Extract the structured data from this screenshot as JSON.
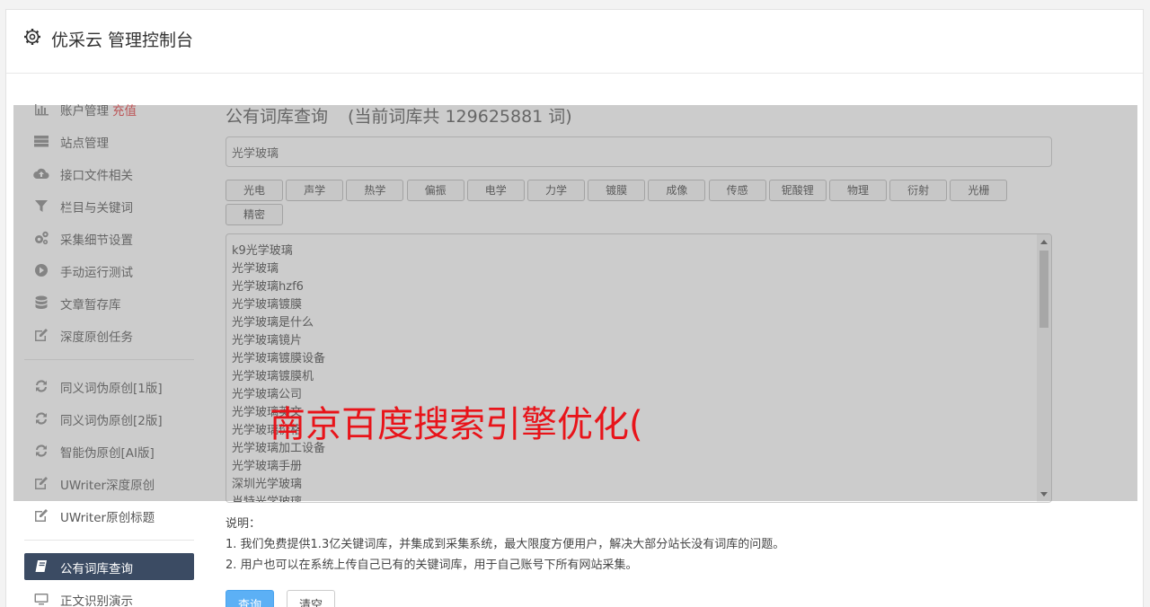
{
  "header": {
    "title": "优采云 管理控制台"
  },
  "sidebar": {
    "items": [
      {
        "label": "账户管理",
        "extra": "充值",
        "icon": "bar-chart-icon"
      },
      {
        "label": "站点管理",
        "icon": "server-icon"
      },
      {
        "label": "接口文件相关",
        "icon": "cloud-upload-icon"
      },
      {
        "label": "栏目与关键词",
        "icon": "filter-icon"
      },
      {
        "label": "采集细节设置",
        "icon": "gears-icon"
      },
      {
        "label": "手动运行测试",
        "icon": "play-circle-icon"
      },
      {
        "label": "文章暂存库",
        "icon": "database-icon"
      },
      {
        "label": "深度原创任务",
        "icon": "edit-icon"
      },
      {
        "label": "同义词伪原创[1版]",
        "icon": "refresh-icon"
      },
      {
        "label": "同义词伪原创[2版]",
        "icon": "refresh-icon"
      },
      {
        "label": "智能伪原创[AI版]",
        "icon": "refresh-icon"
      },
      {
        "label": "UWriter深度原创",
        "icon": "edit-icon"
      },
      {
        "label": "UWriter原创标题",
        "icon": "edit-icon"
      },
      {
        "label": "公有词库查询",
        "icon": "book-icon",
        "active": true
      },
      {
        "label": "正文识别演示",
        "icon": "monitor-icon"
      }
    ]
  },
  "main": {
    "title": "公有词库查询",
    "count_text": "(当前词库共 129625881 词)",
    "search_value": "光学玻璃",
    "tags": [
      "光电",
      "声学",
      "热学",
      "偏振",
      "电学",
      "力学",
      "镀膜",
      "成像",
      "传感",
      "铌酸锂",
      "物理",
      "衍射",
      "光栅",
      "精密"
    ],
    "results": [
      "k9光学玻璃",
      "光学玻璃",
      "光学玻璃hzf6",
      "光学玻璃镀膜",
      "光学玻璃是什么",
      "光学玻璃镜片",
      "光学玻璃镀膜设备",
      "光学玻璃镀膜机",
      "光学玻璃公司",
      "光学玻璃英文",
      "光学玻璃价格",
      "光学玻璃加工设备",
      "光学玻璃手册",
      "深圳光学玻璃",
      "肖特光学玻璃"
    ],
    "notes": {
      "heading": "说明：",
      "line1": "1. 我们免费提供1.3亿关键词库，并集成到采集系统，最大限度方便用户，解决大部分站长没有词库的问题。",
      "line2": "2. 用户也可以在系统上传自己已有的关键词库，用于自己账号下所有网站采集。"
    },
    "buttons": {
      "query": "查询",
      "clear": "清空"
    }
  },
  "overlay": {
    "text": "南京百度搜索引擎优化("
  },
  "colors": {
    "active_bg": "#3b4b63",
    "accent_red": "#e4393c",
    "primary": "#5cb0f5",
    "overlay_text": "#e8141a"
  }
}
